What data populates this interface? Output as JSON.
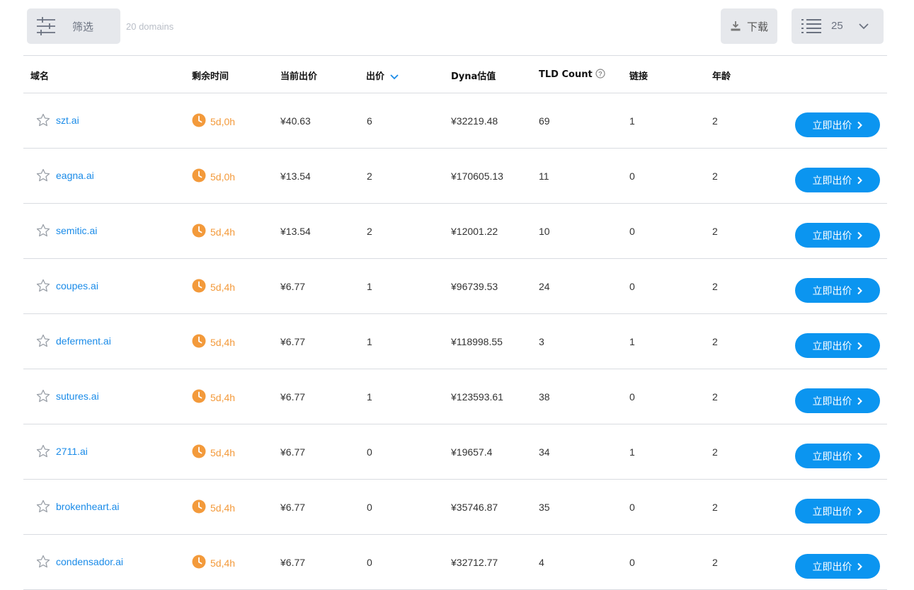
{
  "toolbar": {
    "filter_label": "筛选",
    "domain_count": "20 domains",
    "download_label": "下载",
    "page_size": "25"
  },
  "columns": {
    "domain": "域名",
    "time_left": "剩余时间",
    "current_bid": "当前出价",
    "bids": "出价",
    "dyna": "Dyna估值",
    "tld_count": "TLD Count",
    "links": "链接",
    "age": "年龄"
  },
  "bid_button_label": "立即出价",
  "colors": {
    "accent": "#0b95f0",
    "link": "#1a8be8",
    "timer": "#f39a3b"
  },
  "rows": [
    {
      "domain": "szt.ai",
      "time": "5d,0h",
      "price": "¥40.63",
      "bids": "6",
      "dyna": "¥32219.48",
      "tld": "69",
      "links": "1",
      "age": "2"
    },
    {
      "domain": "eagna.ai",
      "time": "5d,0h",
      "price": "¥13.54",
      "bids": "2",
      "dyna": "¥170605.13",
      "tld": "11",
      "links": "0",
      "age": "2"
    },
    {
      "domain": "semitic.ai",
      "time": "5d,4h",
      "price": "¥13.54",
      "bids": "2",
      "dyna": "¥12001.22",
      "tld": "10",
      "links": "0",
      "age": "2"
    },
    {
      "domain": "coupes.ai",
      "time": "5d,4h",
      "price": "¥6.77",
      "bids": "1",
      "dyna": "¥96739.53",
      "tld": "24",
      "links": "0",
      "age": "2"
    },
    {
      "domain": "deferment.ai",
      "time": "5d,4h",
      "price": "¥6.77",
      "bids": "1",
      "dyna": "¥118998.55",
      "tld": "3",
      "links": "1",
      "age": "2"
    },
    {
      "domain": "sutures.ai",
      "time": "5d,4h",
      "price": "¥6.77",
      "bids": "1",
      "dyna": "¥123593.61",
      "tld": "38",
      "links": "0",
      "age": "2"
    },
    {
      "domain": "2711.ai",
      "time": "5d,4h",
      "price": "¥6.77",
      "bids": "0",
      "dyna": "¥19657.4",
      "tld": "34",
      "links": "1",
      "age": "2"
    },
    {
      "domain": "brokenheart.ai",
      "time": "5d,4h",
      "price": "¥6.77",
      "bids": "0",
      "dyna": "¥35746.87",
      "tld": "35",
      "links": "0",
      "age": "2"
    },
    {
      "domain": "condensador.ai",
      "time": "5d,4h",
      "price": "¥6.77",
      "bids": "0",
      "dyna": "¥32712.77",
      "tld": "4",
      "links": "0",
      "age": "2"
    }
  ]
}
